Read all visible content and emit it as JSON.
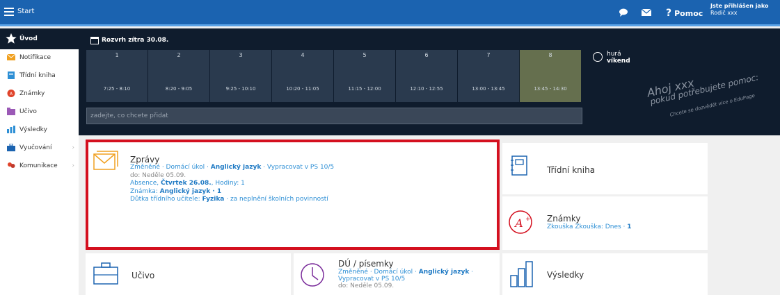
{
  "topbar": {
    "title": "Start",
    "help": "Pomoc",
    "login_line1": "Jste přihlášen jako",
    "login_line2": "Rodič xxx"
  },
  "sidebar": {
    "items": [
      {
        "label": "Úvod",
        "icon": "star-icon"
      },
      {
        "label": "Notifikace",
        "icon": "envelope-icon"
      },
      {
        "label": "Třídní kniha",
        "icon": "book-icon"
      },
      {
        "label": "Známky",
        "icon": "grade-icon"
      },
      {
        "label": "Učivo",
        "icon": "folder-icon"
      },
      {
        "label": "Výsledky",
        "icon": "bar-chart-icon"
      },
      {
        "label": "Vyučování",
        "icon": "briefcase-icon"
      },
      {
        "label": "Komunikace",
        "icon": "people-icon"
      }
    ]
  },
  "schedule": {
    "title": "Rozvrh zítra 30.08.",
    "slots": [
      {
        "n": "1",
        "time": "7:25 - 8:10"
      },
      {
        "n": "2",
        "time": "8:20 - 9:05"
      },
      {
        "n": "3",
        "time": "9:25 - 10:10"
      },
      {
        "n": "4",
        "time": "10:20 - 11:05"
      },
      {
        "n": "5",
        "time": "11:15 - 12:00"
      },
      {
        "n": "6",
        "time": "12:10 - 12:55"
      },
      {
        "n": "7",
        "time": "13:00 - 13:45"
      },
      {
        "n": "8",
        "time": "13:45 - 14:30"
      }
    ],
    "hura1": "hurá",
    "hura2": "víkend",
    "input_placeholder": "zadejte, co chcete přidat"
  },
  "greeting": {
    "line1": "Ahoj xxx",
    "line2": "pokud potřebujete pomoc:",
    "line3": "Chcete se dozvědět více o EduPage"
  },
  "zpravy": {
    "title": "Zprávy",
    "l1a": "Změněné · Domácí úkol · ",
    "l1b": "Anglický jazyk",
    "l1c": " · Vypracovat v PS 10/5",
    "l2": "do: Neděle 05.09.",
    "l3a": "Absence, ",
    "l3b": "Čtvrtek 26.08.",
    "l3c": ", Hodiny: 1",
    "l4a": "Známka: ",
    "l4b": "Anglický jazyk · 1",
    "l5a": "Důtka třídního učitele: ",
    "l5b": "Fyzika",
    "l5c": " · za neplnění školních povinností"
  },
  "tiles": {
    "trida": "Třídní kniha",
    "znamky": "Známky",
    "znamky_sub_a": "Zkouška Zkouška: Dnes · ",
    "znamky_sub_b": "1",
    "ucivo": "Učivo",
    "du": "DÚ / písemky",
    "du_l1a": "Změněné · Domácí úkol · ",
    "du_l1b": "Anglický jazyk",
    "du_l1c": " ·",
    "du_l2": "Vypracovat v PS 10/5",
    "du_l3": "do: Neděle 05.09.",
    "vysledky": "Výsledky"
  },
  "colors": {
    "topbar": "#1b63b0",
    "dark": "#0f1c2d",
    "highlight": "#d4101f",
    "accent": "#2d8fd5"
  }
}
